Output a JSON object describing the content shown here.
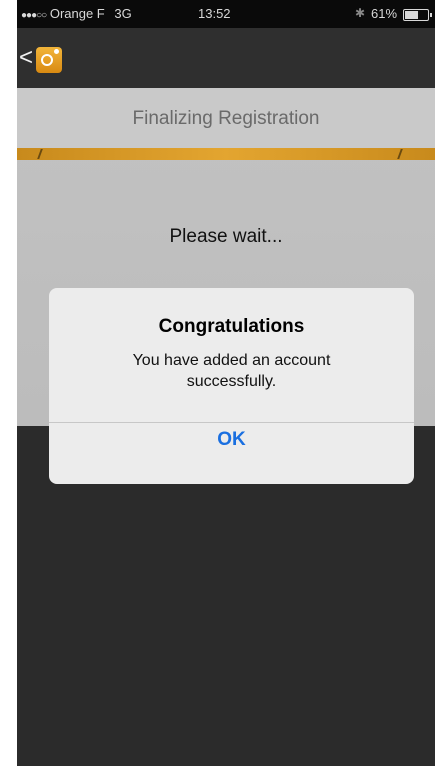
{
  "status_bar": {
    "signal_dots": "●●●○○",
    "carrier": "Orange F",
    "network": "3G",
    "time": "13:52",
    "bluetooth_glyph": "✱",
    "battery_percent": "61%",
    "battery_level": 0.61
  },
  "nav_bar": {
    "back_glyph": "<",
    "logo_icon": "outlook-app-icon"
  },
  "main": {
    "title": "Finalizing Registration",
    "wait_text": "Please wait..."
  },
  "alert": {
    "title": "Congratulations",
    "message": "You have added an account successfully.",
    "ok_label": "OK"
  },
  "colors": {
    "accent_orange": "#e3a530",
    "ok_blue": "#1a6fe0",
    "alert_background": "#ececec"
  }
}
